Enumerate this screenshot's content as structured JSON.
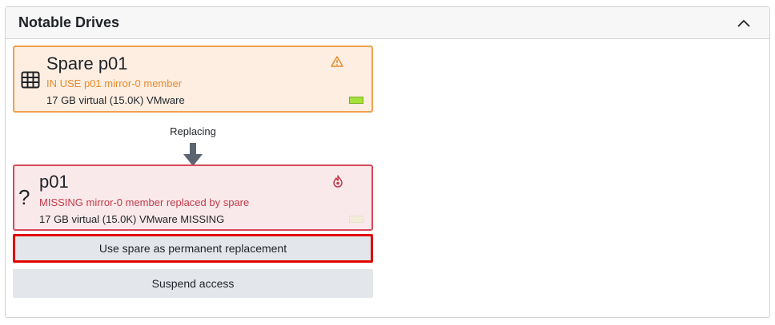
{
  "panel": {
    "title": "Notable Drives"
  },
  "spare_drive": {
    "name": "Spare p01",
    "status": "IN USE p01 mirror-0 member",
    "detail": "17 GB virtual (15.0K) VMware",
    "icon": "grid-icon",
    "alert_icon": "warning-icon",
    "status_color": "#e88a2a",
    "bar_color": "#a4e23a"
  },
  "relation": {
    "label": "Replacing"
  },
  "missing_drive": {
    "name": "p01",
    "status": "MISSING mirror-0 member replaced by spare",
    "detail": "17 GB virtual (15.0K) VMware MISSING",
    "icon": "question-mark-icon",
    "lead_glyph": "?",
    "alert_icon": "fire-icon",
    "status_color": "#c23a4a"
  },
  "actions": {
    "replace_label": "Use spare as permanent replacement",
    "suspend_label": "Suspend access"
  }
}
